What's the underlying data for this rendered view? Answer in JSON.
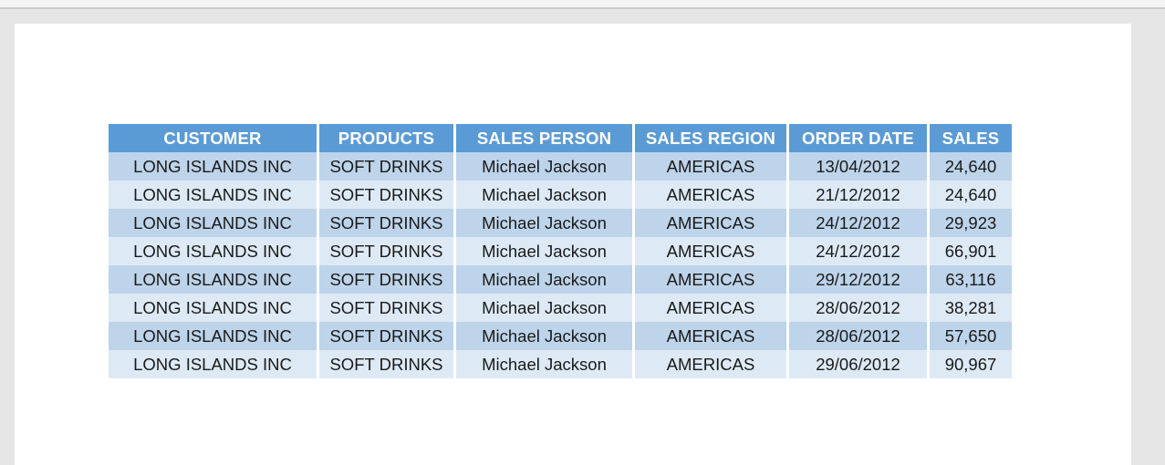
{
  "window": {
    "page_background": "#ffffff",
    "canvas_background": "#e6e6e6"
  },
  "table": {
    "name": "sales-table",
    "header_background": "#5b9bd5",
    "header_text_color": "#ffffff",
    "row_odd_background": "#bdd4ea",
    "row_even_background": "#ddeaf6",
    "columns": [
      {
        "key": "customer",
        "label": "CUSTOMER"
      },
      {
        "key": "products",
        "label": "PRODUCTS"
      },
      {
        "key": "salesperson",
        "label": "SALES PERSON"
      },
      {
        "key": "salesregion",
        "label": "SALES REGION"
      },
      {
        "key": "orderdate",
        "label": "ORDER DATE"
      },
      {
        "key": "sales",
        "label": "SALES"
      }
    ],
    "rows": [
      {
        "customer": "LONG ISLANDS INC",
        "products": "SOFT DRINKS",
        "salesperson": "Michael Jackson",
        "salesregion": "AMERICAS",
        "orderdate": "13/04/2012",
        "sales": "24,640"
      },
      {
        "customer": "LONG ISLANDS INC",
        "products": "SOFT DRINKS",
        "salesperson": "Michael Jackson",
        "salesregion": "AMERICAS",
        "orderdate": "21/12/2012",
        "sales": "24,640"
      },
      {
        "customer": "LONG ISLANDS INC",
        "products": "SOFT DRINKS",
        "salesperson": "Michael Jackson",
        "salesregion": "AMERICAS",
        "orderdate": "24/12/2012",
        "sales": "29,923"
      },
      {
        "customer": "LONG ISLANDS INC",
        "products": "SOFT DRINKS",
        "salesperson": "Michael Jackson",
        "salesregion": "AMERICAS",
        "orderdate": "24/12/2012",
        "sales": "66,901"
      },
      {
        "customer": "LONG ISLANDS INC",
        "products": "SOFT DRINKS",
        "salesperson": "Michael Jackson",
        "salesregion": "AMERICAS",
        "orderdate": "29/12/2012",
        "sales": "63,116"
      },
      {
        "customer": "LONG ISLANDS INC",
        "products": "SOFT DRINKS",
        "salesperson": "Michael Jackson",
        "salesregion": "AMERICAS",
        "orderdate": "28/06/2012",
        "sales": "38,281"
      },
      {
        "customer": "LONG ISLANDS INC",
        "products": "SOFT DRINKS",
        "salesperson": "Michael Jackson",
        "salesregion": "AMERICAS",
        "orderdate": "28/06/2012",
        "sales": "57,650"
      },
      {
        "customer": "LONG ISLANDS INC",
        "products": "SOFT DRINKS",
        "salesperson": "Michael Jackson",
        "salesregion": "AMERICAS",
        "orderdate": "29/06/2012",
        "sales": "90,967"
      }
    ]
  }
}
